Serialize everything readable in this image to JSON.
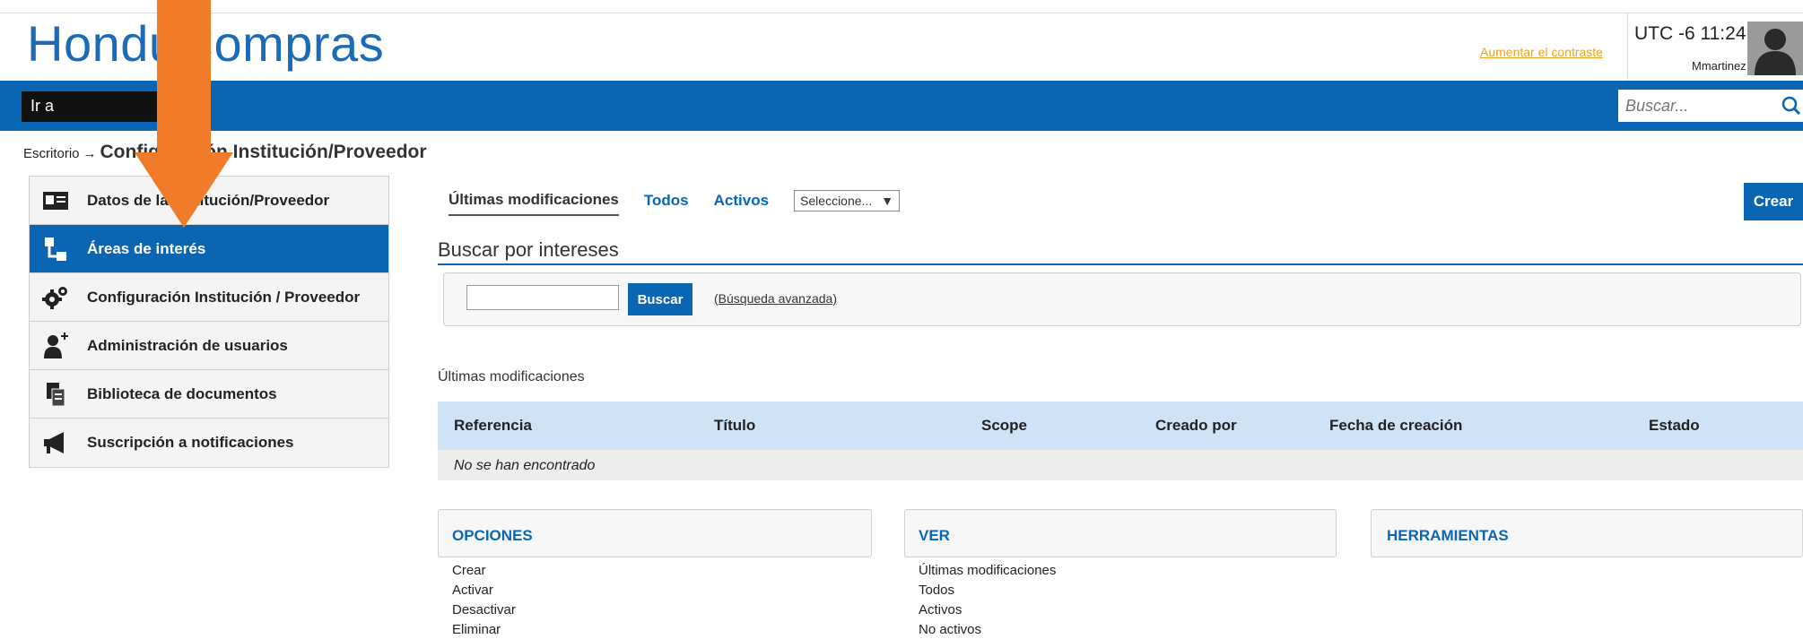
{
  "header": {
    "logo": "HonduCompras",
    "contrast_link": "Aumentar el contraste",
    "clock": "UTC -6 11:24:54",
    "username": "Mmartinez"
  },
  "navbar": {
    "goto_label": "Ir a",
    "search_placeholder": "Buscar..."
  },
  "breadcrumb": {
    "root": "Escritorio",
    "arrow": "→",
    "current": "Configuración Institución/Proveedor"
  },
  "sidebar": {
    "items": [
      {
        "label": "Datos de la Institución/Proveedor",
        "icon": "id-card-icon"
      },
      {
        "label": "Áreas de interés",
        "icon": "hierarchy-icon"
      },
      {
        "label": "Configuración Institución / Proveedor",
        "icon": "gears-icon"
      },
      {
        "label": "Administración de usuarios",
        "icon": "add-user-icon"
      },
      {
        "label": "Biblioteca de documentos",
        "icon": "documents-icon"
      },
      {
        "label": "Suscripción a notificaciones",
        "icon": "megaphone-icon"
      }
    ],
    "active_index": 1
  },
  "main": {
    "tabs": [
      "Últimas modificaciones",
      "Todos",
      "Activos"
    ],
    "select_value": "Seleccione...",
    "create_button": "Crear",
    "section_title": "Buscar por intereses",
    "search_button": "Buscar",
    "advanced_link": "(Búsqueda avanzada)",
    "recent_label": "Últimas modificaciones",
    "table": {
      "columns": [
        "Referencia",
        "Título",
        "Scope",
        "Creado por",
        "Fecha de creación",
        "Estado"
      ],
      "empty_text": "No se han encontrado"
    }
  },
  "panels": {
    "opciones": {
      "title": "OPCIONES",
      "items": [
        "Crear",
        "Activar",
        "Desactivar",
        "Eliminar"
      ]
    },
    "ver": {
      "title": "VER",
      "items": [
        "Últimas modificaciones",
        "Todos",
        "Activos",
        "No activos"
      ]
    },
    "herramientas": {
      "title": "HERRAMIENTAS",
      "items": []
    }
  },
  "colors": {
    "brand_blue": "#0a66b2",
    "arrow_orange": "#f07c2a",
    "contrast_link": "#f0a020"
  }
}
